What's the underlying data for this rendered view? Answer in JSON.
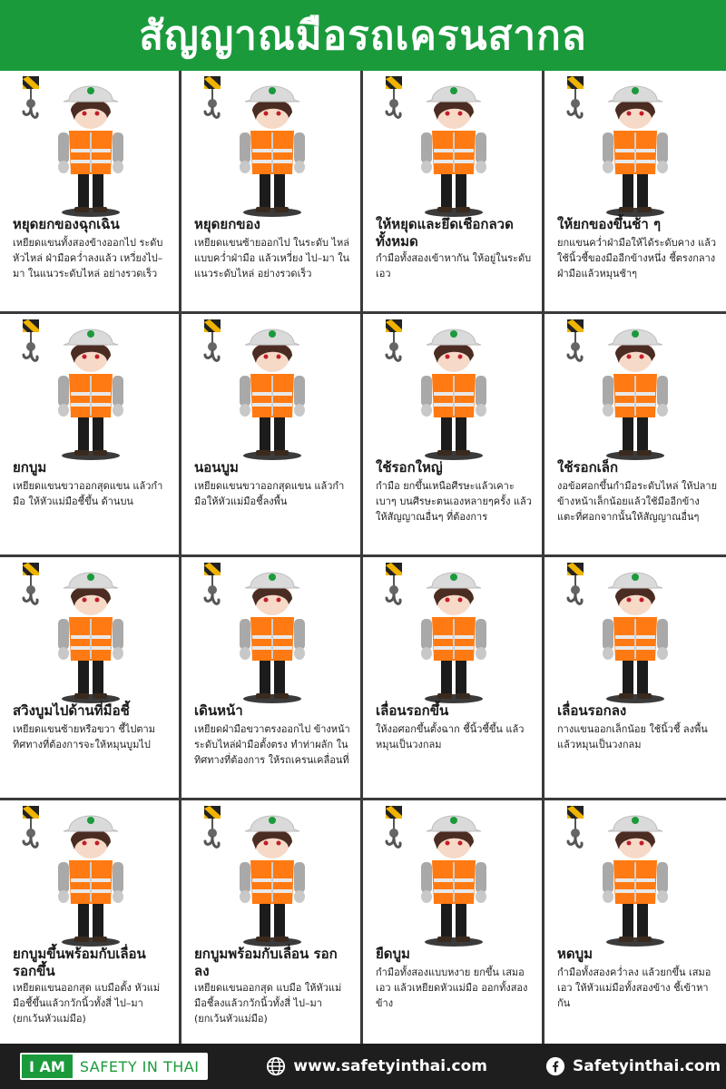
{
  "header": {
    "title": "สัญญาณมือรถเครนสากล"
  },
  "colors": {
    "brand_green": "#1b9a3c",
    "vest_orange": "#ff7a12",
    "footer_bg": "#1e1e1e",
    "divider": "#3a3a3a"
  },
  "signals": [
    {
      "title": "หยุดยกของฉุกเฉิน",
      "desc": "เหยียดแขนทั้งสองข้างออกไป ระดับหัวไหล่ ฝ่ามือคว่ำลงแล้ว เหวี่ยงไป–มา ในแนวระดับไหล่ อย่างรวดเร็ว"
    },
    {
      "title": "หยุดยกของ",
      "desc": "เหยียดแขนซ้ายออกไป ในระดับ ไหล่ แบบคว่ำฝ่ามือ แล้วเหวี่ยง ไป–มา ในแนวระดับไหล่ อย่างรวดเร็ว"
    },
    {
      "title": "ให้หยุดและยึดเชือกลวด ทั้งหมด",
      "desc": "กำมือทั้งสองเข้าหากัน ให้อยู่ในระดับเอว"
    },
    {
      "title": "ให้ยกของขึ้นช้า ๆ",
      "desc": "ยกแขนคว่ำฝ่ามือให้ได้ระดับคาง แล้วใช้นิ้วชี้ของมืออีกข้างหนึ่ง ชี้ตรงกลางฝ่ามือแล้วหมุนช้าๆ"
    },
    {
      "title": "ยกบูม",
      "desc": "เหยียดแขนขวาออกสุดแขน แล้วกำมือ ให้หัวแม่มือชี้ขึ้น ด้านบน"
    },
    {
      "title": "นอนบูม",
      "desc": "เหยียดแขนขวาออกสุดแขน แล้วกำมือให้หัวแม่มือชี้ลงพื้น"
    },
    {
      "title": "ใช้รอกใหญ่",
      "desc": "กำมือ ยกขึ้นเหนือศีรษะแล้วเคาะ เบาๆ บนศีรษะตนเองหลายๆครั้ง แล้วให้สัญญาณอื่นๆ ที่ต้องการ"
    },
    {
      "title": "ใช้รอกเล็ก",
      "desc": "งอข้อศอกขึ้นกำมือระดับไหล่ ให้ปลาย ข้างหน้าเล็กน้อยแล้วใช้มืออีกข้าง แตะที่ศอกจากนั้นให้สัญญาณอื่นๆ"
    },
    {
      "title": "สวิงบูมไปด้านที่มือชี้",
      "desc": "เหยียดแขนซ้ายหรือขวา ชี้ไปตาม ทิศทางที่ต้องการจะให้หมุนบูมไป"
    },
    {
      "title": "เดินหน้า",
      "desc": "เหยียดฝ่ามือขวาตรงออกไป ข้างหน้า ระดับไหล่ฝ่ามือตั้งตรง ทำท่าผลัก ในทิศทางที่ต้องการ ให้รถเครนเคลื่อนที่"
    },
    {
      "title": "เลื่อนรอกขึ้น",
      "desc": "ให้งอศอกขึ้นตั้งฉาก ชี้นิ้วชี้ขึ้น แล้วหมุนเป็นวงกลม"
    },
    {
      "title": "เลื่อนรอกลง",
      "desc": "กางแขนออกเล็กน้อย ใช้นิ้วชี้ ลงพื้น แล้วหมุนเป็นวงกลม"
    },
    {
      "title": "ยกบูมขึ้นพร้อมกับเลื่อน รอกขึ้น",
      "desc": "เหยียดแขนออกสุด แบมือตั้ง หัวแม่มือชี้ขึ้นแล้วกวักนิ้วทั้งสี่ ไป–มา (ยกเว้นหัวแม่มือ)"
    },
    {
      "title": "ยกบูมพร้อมกับเลื่อน รอกลง",
      "desc": "เหยียดแขนออกสุด แบมือ ให้หัวแม่มือชี้ลงแล้วกวักนิ้วทั้งสี่ ไป–มา (ยกเว้นหัวแม่มือ)"
    },
    {
      "title": "ยืดบูม",
      "desc": "กำมือทั้งสองแบบหงาย ยกขึ้น เสมอเอว แล้วเหยียดหัวแม่มือ ออกทั้งสองข้าง"
    },
    {
      "title": "หดบูม",
      "desc": "กำมือทั้งสองคว่ำลง แล้วยกขึ้น เสมอเอว ให้หัวแม่มือทั้งสองข้าง ชี้เข้าหากัน"
    }
  ],
  "footer": {
    "brand_left": "I AM",
    "brand_right": "SAFETY IN THAI",
    "website": "www.safetyinthai.com",
    "facebook": "Safetyinthai.com",
    "website_icon": "globe-icon",
    "facebook_icon": "facebook-icon"
  }
}
